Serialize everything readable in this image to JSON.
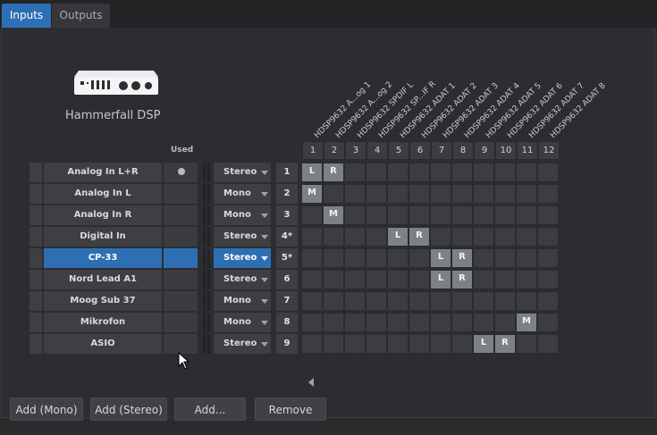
{
  "tabs": [
    {
      "label": "Inputs",
      "active": true
    },
    {
      "label": "Outputs",
      "active": false
    }
  ],
  "device": {
    "name": "Hammerfall DSP",
    "icon": "audio-interface-icon"
  },
  "used_header": "Used",
  "outputs": [
    "HDSP9632 A...og 1",
    "HDSP9632 A...og 2",
    "HDSP9632 SPDIF L",
    "HDSP9632 SP...IF R",
    "HDSP9632 ADAT 1",
    "HDSP9632 ADAT 2",
    "HDSP9632 ADAT 3",
    "HDSP9632 ADAT 4",
    "HDSP9632 ADAT 5",
    "HDSP9632 ADAT 6",
    "HDSP9632 ADAT 7",
    "HDSP9632 ADAT 8"
  ],
  "column_numbers": [
    "1",
    "2",
    "3",
    "4",
    "5",
    "6",
    "7",
    "8",
    "9",
    "10",
    "11",
    "12"
  ],
  "inputs": [
    {
      "name": "Analog In L+R",
      "used": true,
      "selected": false,
      "channel": "Stereo",
      "num": "1"
    },
    {
      "name": "Analog In L",
      "used": false,
      "selected": false,
      "channel": "Mono",
      "num": "2"
    },
    {
      "name": "Analog In R",
      "used": false,
      "selected": false,
      "channel": "Mono",
      "num": "3"
    },
    {
      "name": "Digital In",
      "used": false,
      "selected": false,
      "channel": "Stereo",
      "num": "4*"
    },
    {
      "name": "CP-33",
      "used": false,
      "selected": true,
      "channel": "Stereo",
      "num": "5*"
    },
    {
      "name": "Nord Lead A1",
      "used": false,
      "selected": false,
      "channel": "Stereo",
      "num": "6"
    },
    {
      "name": "Moog Sub 37",
      "used": false,
      "selected": false,
      "channel": "Mono",
      "num": "7"
    },
    {
      "name": "Mikrofon",
      "used": false,
      "selected": false,
      "channel": "Mono",
      "num": "8"
    },
    {
      "name": "ASIO",
      "used": false,
      "selected": false,
      "channel": "Stereo",
      "num": "9"
    }
  ],
  "assignments": [
    {
      "row": 0,
      "col": 1,
      "label": "L"
    },
    {
      "row": 0,
      "col": 2,
      "label": "R"
    },
    {
      "row": 1,
      "col": 1,
      "label": "M"
    },
    {
      "row": 2,
      "col": 2,
      "label": "M"
    },
    {
      "row": 3,
      "col": 5,
      "label": "L"
    },
    {
      "row": 3,
      "col": 6,
      "label": "R"
    },
    {
      "row": 4,
      "col": 7,
      "label": "L"
    },
    {
      "row": 4,
      "col": 8,
      "label": "R"
    },
    {
      "row": 5,
      "col": 7,
      "label": "L"
    },
    {
      "row": 5,
      "col": 8,
      "label": "R"
    },
    {
      "row": 7,
      "col": 11,
      "label": "M"
    },
    {
      "row": 8,
      "col": 9,
      "label": "L"
    },
    {
      "row": 8,
      "col": 10,
      "label": "R"
    }
  ],
  "buttons": {
    "add_mono": "Add (Mono)",
    "add_stereo": "Add (Stereo)",
    "add": "Add...",
    "remove": "Remove"
  }
}
